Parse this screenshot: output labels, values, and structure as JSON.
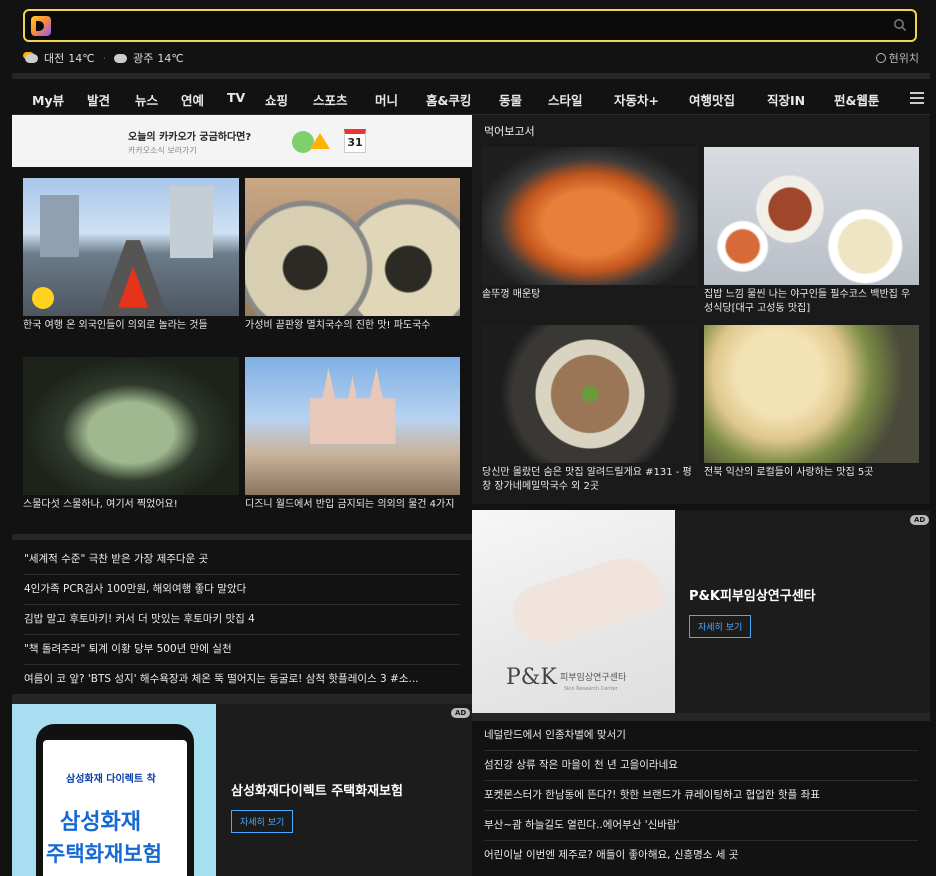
{
  "search": {
    "placeholder": ""
  },
  "weather": {
    "city1": "대전",
    "temp1": "14℃",
    "city2": "광주",
    "temp2": "14℃",
    "location_label": "현위치"
  },
  "nav": {
    "items": [
      "My뷰",
      "발견",
      "뉴스",
      "연예",
      "TV",
      "쇼핑",
      "스포츠",
      "머니",
      "홈&쿠킹",
      "동물",
      "스타일",
      "자동차+",
      "여행맛집",
      "직장IN",
      "펀&웹툰"
    ],
    "active": "여행맛집"
  },
  "banner": {
    "title": "오늘의 카카오가 궁금하다면?",
    "subtitle": "카카오소식 보러가기",
    "calendar_day": "31"
  },
  "left_cards": [
    {
      "caption": "한국 여행 온 외국인들이 의외로 놀라는 것들"
    },
    {
      "caption": "가성비 끝판왕 멸치국수의 진한 맛! 파도국수"
    },
    {
      "caption": "스물다섯 스물하나, 여기서 찍었어요!"
    },
    {
      "caption": "디즈니 월드에서 반입 금지되는 의외의 물건 4가지"
    }
  ],
  "left_news": [
    "\"세계적 수준\" 극찬 받은 가장 제주다운 곳",
    "4인가족 PCR검사 100만원, 해외여행 좋다 말았다",
    "김밥 말고 후토마키! 커서 더 맛있는 후토마키 맛집 4",
    "\"책 돌려주라\" 퇴계 이황 당부 500년 만에 실천",
    "여름이 코 앞? 'BTS 성지' 해수욕장과 체온 뚝 떨어지는 동굴로! 삼척 핫플레이스 3 #소..."
  ],
  "right_section": {
    "title": "먹어보고서",
    "cards": [
      {
        "caption": "솥뚜껑 매운탕"
      },
      {
        "caption": "집밥 느낌 물씬 나는 야구인들 필수코스 백반집 우성식당[대구 고성동 맛집]"
      },
      {
        "caption": "당신만 몰랐던 숨은 맛집 알려드릴게요 #131 - 평창 장가네메밀막국수 외 2곳"
      },
      {
        "caption": "전북 익산의 로컬들이 사랑하는 맛집 5곳"
      }
    ]
  },
  "ad1": {
    "badge": "AD",
    "title": "P&K피부임상연구센타",
    "button": "자세히 보기",
    "logo_text": "P&K",
    "logo_sub": "피부임상연구센타",
    "logo_sub2": "Skin Research Center"
  },
  "ad2": {
    "badge": "AD",
    "title": "삼성화재다이렉트 주택화재보험",
    "button": "자세히 보기",
    "brand": "삼성화재 다이렉트 착",
    "big1": "삼성화재",
    "big2": "주택화재보험"
  },
  "right_news": [
    "네덜란드에서 인종차별에 맞서기",
    "섬진강 상류 작은 마을이 천 년 고을이라네요",
    "포켓몬스터가 한남동에 뜬다?! 핫한 브랜드가 큐레이팅하고 협업한 핫플 좌표",
    "부산~괌 하늘길도 열린다..에어부산 '신바람'",
    "어린이날 이번엔 제주로? 애들이 좋아해요, 신흥명소 세 곳"
  ],
  "colors": {
    "search_border": "#f2d64a",
    "ad_button": "#4aa8ff",
    "background": "#121212"
  }
}
